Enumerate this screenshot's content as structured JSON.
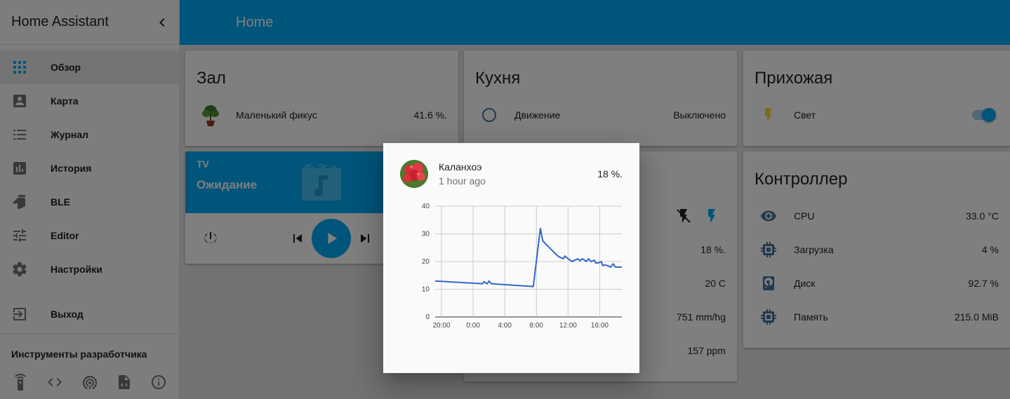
{
  "sidebar": {
    "title": "Home Assistant",
    "items": [
      {
        "label": "Обзор",
        "icon": "grid-icon",
        "active": true
      },
      {
        "label": "Карта",
        "icon": "account-box-icon"
      },
      {
        "label": "Журнал",
        "icon": "list-icon"
      },
      {
        "label": "История",
        "icon": "chart-bar-icon"
      },
      {
        "label": "BLE",
        "icon": "thumb-icon"
      },
      {
        "label": "Editor",
        "icon": "tune-icon"
      },
      {
        "label": "Настройки",
        "icon": "gear-icon"
      }
    ],
    "logout_label": "Выход",
    "devtools_title": "Инструменты разработчика",
    "devtools": [
      "remote-icon",
      "code-icon",
      "broadcast-icon",
      "file-code-icon",
      "info-icon"
    ]
  },
  "topbar": {
    "title": "Home"
  },
  "cards": {
    "zal": {
      "title": "Зал",
      "rows": [
        {
          "name": "Маленький фикус",
          "value": "41.6 %."
        }
      ]
    },
    "kitchen": {
      "title": "Кухня",
      "rows": [
        {
          "name": "Движение",
          "value": "Выключено"
        }
      ]
    },
    "hall": {
      "title": "Прихожая",
      "rows": [
        {
          "name": "Свет",
          "toggle_on": true
        }
      ]
    },
    "media": {
      "name": "TV",
      "state": "Ожидание"
    },
    "kitchen2": {
      "rows": [
        {
          "value": "18 %."
        },
        {
          "value": "20 C"
        },
        {
          "value": "751 mm/hg"
        },
        {
          "value": "157 ppm"
        }
      ]
    },
    "controller": {
      "title": "Контроллер",
      "rows": [
        {
          "name": "CPU",
          "value": "33.0 °C",
          "icon": "eye-icon"
        },
        {
          "name": "Загрузка",
          "value": "4 %",
          "icon": "chip-icon"
        },
        {
          "name": "Диск",
          "value": "92.7 %",
          "icon": "harddisk-icon"
        },
        {
          "name": "Память",
          "value": "215.0 MiB",
          "icon": "chip-icon"
        }
      ]
    }
  },
  "dialog": {
    "name": "Каланхоэ",
    "time": "1 hour ago",
    "value": "18 %.",
    "chart_data": {
      "type": "line",
      "ylim": [
        0,
        40
      ],
      "yticks": [
        0,
        10,
        20,
        30,
        40
      ],
      "xticks": [
        "20:00",
        "0:00",
        "4:00",
        "8:00",
        "12:00",
        "16:00"
      ],
      "xunit": "hours from 20:00",
      "series": [
        {
          "color": "#3366cc",
          "x": [
            -0.8,
            5.2,
            5.4,
            5.6,
            5.8,
            6.0,
            6.3,
            11.6,
            12.5,
            12.8,
            13.3,
            14.0,
            14.7,
            15.0,
            15.4,
            15.6,
            15.8,
            16.0,
            16.5,
            17.2,
            17.5,
            17.8,
            18.1,
            18.3,
            18.6,
            18.9,
            19.3,
            19.5,
            19.8,
            20.2,
            20.4,
            20.6,
            21.0,
            21.4,
            21.7,
            22.0,
            22.4,
            22.8
          ],
          "y": [
            13,
            12,
            12.8,
            12.2,
            12,
            13,
            12,
            11,
            32,
            27.5,
            26,
            24,
            22,
            21.5,
            21,
            22,
            21.5,
            21,
            20,
            21,
            20.3,
            21,
            20.5,
            20,
            21,
            20,
            20.5,
            19.5,
            19.5,
            20,
            18.5,
            18.8,
            18.5,
            18,
            19.2,
            18,
            18,
            18
          ]
        }
      ]
    }
  }
}
